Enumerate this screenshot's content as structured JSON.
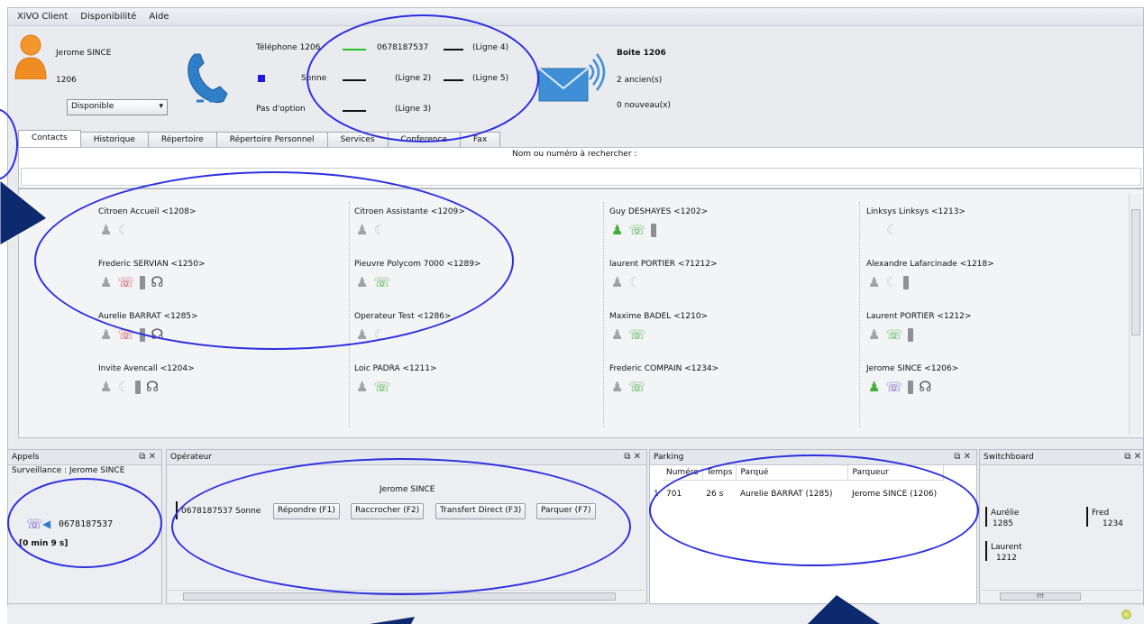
{
  "menu": [
    "XiVO Client",
    "Disponibilité",
    "Aide"
  ],
  "identity": {
    "name": "Jerome SINCE",
    "ext": "1206",
    "availability": "Disponible"
  },
  "lines": {
    "telephone_label": "Téléphone 1206",
    "number": "0678187537",
    "ligne4": "(Ligne 4)",
    "sonne_label": "Sonne",
    "ligne2": "(Ligne 2)",
    "ligne5": "(Ligne 5)",
    "option_label": "Pas d'option",
    "ligne3": "(Ligne 3)"
  },
  "voicemail": {
    "title": "Boite 1206",
    "old": "2 ancien(s)",
    "new": "0 nouveau(x)"
  },
  "tabs": [
    "Contacts",
    "Historique",
    "Répertoire",
    "Répertoire Personnel",
    "Services",
    "Conference",
    "Fax"
  ],
  "search": {
    "label": "Nom ou numéro à rechercher :"
  },
  "contacts": [
    {
      "name": "Citroen Accueil <1208>",
      "icons": [
        "user-grey",
        "phone-grey"
      ]
    },
    {
      "name": "Citroen Assistante <1209>",
      "icons": [
        "user-grey",
        "phone-grey"
      ]
    },
    {
      "name": "Guy DESHAYES <1202>",
      "icons": [
        "user-green",
        "phone-green",
        "mobile"
      ]
    },
    {
      "name": "Linksys Linksys <1213>",
      "icons": [
        "none",
        "phone-grey"
      ]
    },
    {
      "name": "Frederic SERVIAN <1250>",
      "icons": [
        "user-grey",
        "phone-red",
        "mobile",
        "agent"
      ]
    },
    {
      "name": "Pieuvre Polycom 7000 <1289>",
      "icons": [
        "user-grey",
        "phone-green"
      ]
    },
    {
      "name": "laurent PORTIER <71212>",
      "icons": [
        "user-grey",
        "phone-grey"
      ]
    },
    {
      "name": "Alexandre Lafarcinade <1218>",
      "icons": [
        "user-grey",
        "phone-grey",
        "mobile"
      ]
    },
    {
      "name": "Aurelie BARRAT <1285>",
      "icons": [
        "user-grey",
        "phone-red",
        "mobile",
        "agent"
      ]
    },
    {
      "name": "Operateur Test <1286>",
      "icons": [
        "user-grey",
        "phone-grey"
      ]
    },
    {
      "name": "Maxime BADEL <1210>",
      "icons": [
        "user-grey",
        "phone-green"
      ]
    },
    {
      "name": "Laurent PORTIER <1212>",
      "icons": [
        "user-grey",
        "phone-green",
        "mobile"
      ]
    },
    {
      "name": "Invite Avencall <1204>",
      "icons": [
        "user-grey",
        "phone-grey",
        "mobile",
        "agent"
      ]
    },
    {
      "name": "Loic PADRA <1211>",
      "icons": [
        "user-grey",
        "phone-green"
      ]
    },
    {
      "name": "Frederic COMPAIN <1234>",
      "icons": [
        "user-grey",
        "phone-green"
      ]
    },
    {
      "name": "Jerome SINCE <1206>",
      "icons": [
        "user-green",
        "phone-purple",
        "mobile",
        "agent"
      ]
    }
  ],
  "appels": {
    "title": "Appels",
    "surveillance": "Surveillance : Jerome SINCE",
    "number": "0678187537",
    "duration": "[0 min 9 s]"
  },
  "operateur": {
    "title": "Opérateur",
    "name": "Jerome SINCE",
    "call": "0678187537 Sonne",
    "buttons": [
      "Répondre (F1)",
      "Raccrocher (F2)",
      "Transfert Direct (F3)",
      "Parquer (F7)"
    ]
  },
  "parking": {
    "title": "Parking",
    "headers": [
      "Numéro",
      "Temps",
      "Parqué",
      "Parqueur"
    ],
    "rows": [
      {
        "index": "1",
        "numero": "701",
        "temps": "26 s",
        "parque": "Aurelie BARRAT (1285)",
        "parqueur": "Jerome SINCE (1206)"
      }
    ]
  },
  "switchboard": {
    "title": "Switchboard",
    "entries": [
      {
        "name": "Aurélie",
        "ext": "1285"
      },
      {
        "name": "Fred",
        "ext": "1234"
      },
      {
        "name": "Laurent",
        "ext": "1212"
      }
    ],
    "scroll_label": "!!!"
  },
  "colors": {
    "annotation": "#2b2fe0",
    "arrow": "#0e2a6e",
    "accent_green": "#3fae3a",
    "accent_red": "#d43c4e",
    "accent_purple": "#6f52c8"
  }
}
